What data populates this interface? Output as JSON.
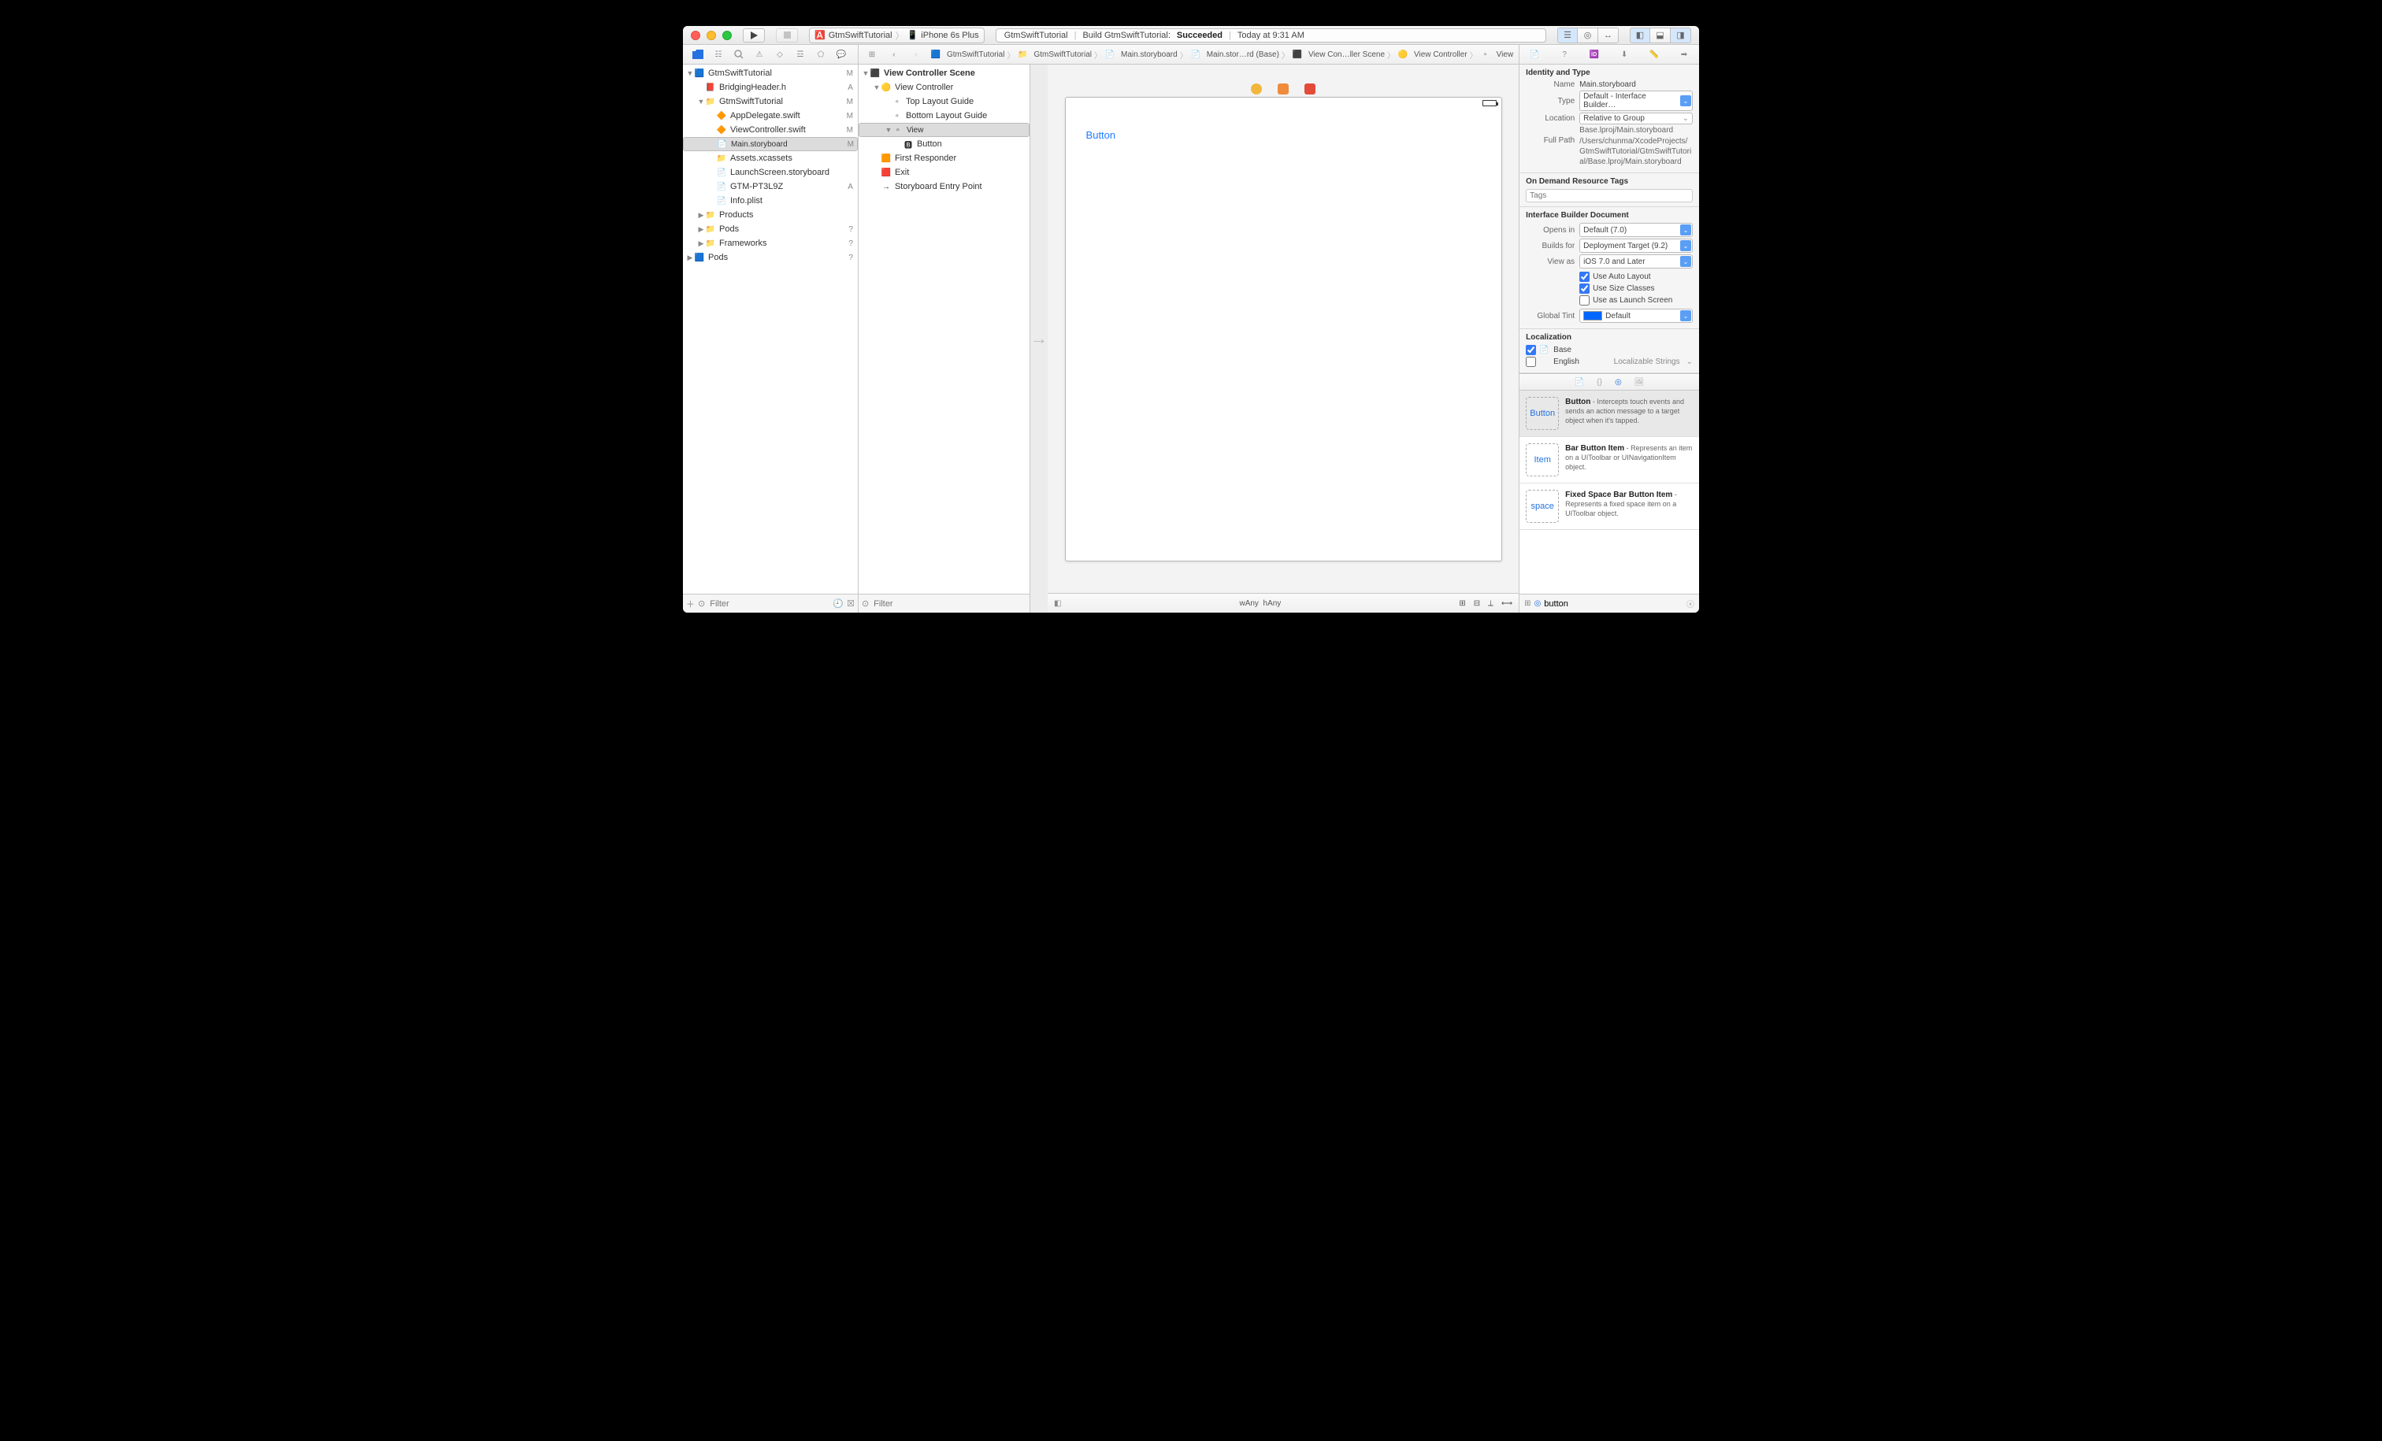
{
  "titlebar": {
    "scheme_app": "GtmSwiftTutorial",
    "scheme_device": "iPhone 6s Plus",
    "status_app": "GtmSwiftTutorial",
    "status_action": "Build GtmSwiftTutorial:",
    "status_result": "Succeeded",
    "status_time": "Today at 9:31 AM"
  },
  "navigator": {
    "filter_placeholder": "Filter",
    "items": [
      {
        "depth": 0,
        "disc": "▼",
        "icon": "proj",
        "label": "GtmSwiftTutorial",
        "stat": "M"
      },
      {
        "depth": 1,
        "disc": "",
        "icon": "h",
        "label": "BridgingHeader.h",
        "stat": "A"
      },
      {
        "depth": 1,
        "disc": "▼",
        "icon": "folder-y",
        "label": "GtmSwiftTutorial",
        "stat": "M"
      },
      {
        "depth": 2,
        "disc": "",
        "icon": "swift",
        "label": "AppDelegate.swift",
        "stat": "M"
      },
      {
        "depth": 2,
        "disc": "",
        "icon": "swift",
        "label": "ViewController.swift",
        "stat": "M"
      },
      {
        "depth": 2,
        "disc": "",
        "icon": "sb",
        "label": "Main.storyboard",
        "stat": "M",
        "sel": true
      },
      {
        "depth": 2,
        "disc": "",
        "icon": "assets",
        "label": "Assets.xcassets",
        "stat": ""
      },
      {
        "depth": 2,
        "disc": "",
        "icon": "sb",
        "label": "LaunchScreen.storyboard",
        "stat": ""
      },
      {
        "depth": 2,
        "disc": "",
        "icon": "file",
        "label": "GTM-PT3L9Z",
        "stat": "A"
      },
      {
        "depth": 2,
        "disc": "",
        "icon": "plist",
        "label": "Info.plist",
        "stat": ""
      },
      {
        "depth": 1,
        "disc": "▶",
        "icon": "folder-y",
        "label": "Products",
        "stat": ""
      },
      {
        "depth": 1,
        "disc": "▶",
        "icon": "folder-y",
        "label": "Pods",
        "stat": "?"
      },
      {
        "depth": 1,
        "disc": "▶",
        "icon": "folder-y",
        "label": "Frameworks",
        "stat": "?"
      },
      {
        "depth": 0,
        "disc": "▶",
        "icon": "proj",
        "label": "Pods",
        "stat": "?"
      }
    ]
  },
  "outline": {
    "filter_placeholder": "Filter",
    "items": [
      {
        "depth": 0,
        "disc": "▼",
        "icon": "scene",
        "label": "View Controller Scene",
        "bold": true
      },
      {
        "depth": 1,
        "disc": "▼",
        "icon": "vc",
        "label": "View Controller"
      },
      {
        "depth": 2,
        "disc": "",
        "icon": "guide",
        "label": "Top Layout Guide"
      },
      {
        "depth": 2,
        "disc": "",
        "icon": "guide",
        "label": "Bottom Layout Guide"
      },
      {
        "depth": 2,
        "disc": "▼",
        "icon": "view",
        "label": "View",
        "sel": true
      },
      {
        "depth": 3,
        "disc": "",
        "icon": "btn",
        "label": "Button"
      },
      {
        "depth": 1,
        "disc": "",
        "icon": "fr",
        "label": "First Responder"
      },
      {
        "depth": 1,
        "disc": "",
        "icon": "exit",
        "label": "Exit"
      },
      {
        "depth": 1,
        "disc": "",
        "icon": "entry",
        "label": "Storyboard Entry Point"
      }
    ]
  },
  "jumpbar": [
    {
      "icon": "proj",
      "label": "GtmSwiftTutorial"
    },
    {
      "icon": "folder",
      "label": "GtmSwiftTutorial"
    },
    {
      "icon": "sb",
      "label": "Main.storyboard"
    },
    {
      "icon": "sb",
      "label": "Main.stor…rd (Base)"
    },
    {
      "icon": "scene",
      "label": "View Con…ller Scene"
    },
    {
      "icon": "vc",
      "label": "View Controller"
    },
    {
      "icon": "view",
      "label": "View"
    }
  ],
  "canvas": {
    "button_text": "Button",
    "size_w": "Any",
    "size_h": "Any"
  },
  "inspector": {
    "identity": {
      "header": "Identity and Type",
      "name_lbl": "Name",
      "name_val": "Main.storyboard",
      "type_lbl": "Type",
      "type_val": "Default - Interface Builder…",
      "loc_lbl": "Location",
      "loc_val": "Relative to Group",
      "loc_path": "Base.lproj/Main.storyboard",
      "fullpath_lbl": "Full Path",
      "fullpath_val": "/Users/chunma/XcodeProjects/GtmSwiftTutorial/GtmSwiftTutorial/Base.lproj/Main.storyboard"
    },
    "odr": {
      "header": "On Demand Resource Tags",
      "placeholder": "Tags"
    },
    "ib": {
      "header": "Interface Builder Document",
      "opensin_lbl": "Opens in",
      "opensin_val": "Default (7.0)",
      "buildsfor_lbl": "Builds for",
      "buildsfor_val": "Deployment Target (9.2)",
      "viewas_lbl": "View as",
      "viewas_val": "iOS 7.0 and Later",
      "cb_autolayout": "Use Auto Layout",
      "cb_sizeclasses": "Use Size Classes",
      "cb_launch": "Use as Launch Screen",
      "tint_lbl": "Global Tint",
      "tint_val": "Default"
    },
    "loc": {
      "header": "Localization",
      "base": "Base",
      "english": "English",
      "english_type": "Localizable Strings"
    },
    "library": {
      "filter_value": "button",
      "items": [
        {
          "name": "Button",
          "thumb": "Button",
          "desc": " - Intercepts touch events and sends an action message to a target object when it's tapped.",
          "sel": true
        },
        {
          "name": "Bar Button Item",
          "thumb": "Item",
          "desc": " - Represents an item on a UIToolbar or UINavigationItem object."
        },
        {
          "name": "Fixed Space Bar Button Item",
          "thumb": "space",
          "desc": " - Represents a fixed space item on a UIToolbar object."
        }
      ]
    }
  }
}
